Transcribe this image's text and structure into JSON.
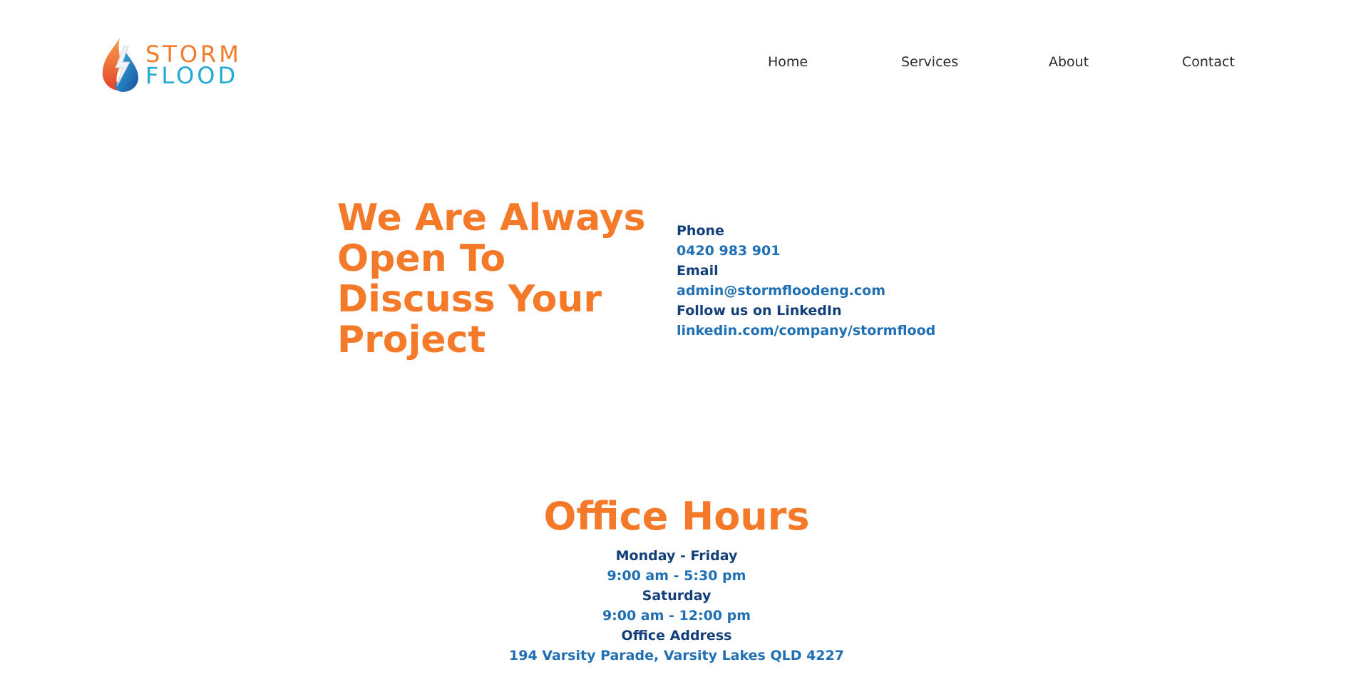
{
  "brand": {
    "name_line1": "STORM",
    "name_line2": "FLOOD",
    "colors": {
      "orange": "#f47a2a",
      "cyan": "#1fa9d6",
      "navy": "#123f7a",
      "blue": "#1f6fb5"
    },
    "icon": "flame-drop-lightning-logo"
  },
  "nav": {
    "items": [
      {
        "label": "Home"
      },
      {
        "label": "Services"
      },
      {
        "label": "About"
      },
      {
        "label": "Contact"
      }
    ]
  },
  "contact": {
    "headline": "We Are Always Open To Discuss Your Project",
    "phone_label": "Phone",
    "phone_value": "0420 983 901",
    "email_label": "Email",
    "email_value": "admin@stormfloodeng.com",
    "linkedin_label": "Follow us on LinkedIn",
    "linkedin_value": "linkedin.com/company/stormflood"
  },
  "hours": {
    "title": "Office Hours",
    "weekday_label": "Monday - Friday",
    "weekday_value": "9:00 am - 5:30 pm",
    "saturday_label": "Saturday",
    "saturday_value": "9:00 am - 12:00 pm",
    "address_label": "Office Address",
    "address_value": "194 Varsity Parade, Varsity Lakes QLD 4227"
  }
}
